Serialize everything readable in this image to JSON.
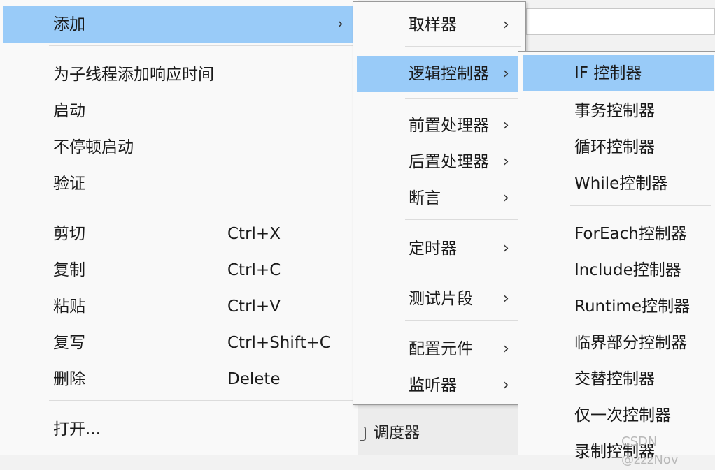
{
  "background": {
    "watermark": "CSDN @zzzNov",
    "underlying_label": "调度器"
  },
  "main_menu": {
    "add": {
      "label": "添加",
      "arrow": "›"
    },
    "group1": [
      {
        "label": "为子线程添加响应时间"
      },
      {
        "label": "启动"
      },
      {
        "label": "不停顿启动"
      },
      {
        "label": "验证"
      }
    ],
    "group2": [
      {
        "label": "剪切",
        "shortcut": "Ctrl+X"
      },
      {
        "label": "复制",
        "shortcut": "Ctrl+C"
      },
      {
        "label": "粘贴",
        "shortcut": "Ctrl+V"
      },
      {
        "label": "复写",
        "shortcut": "Ctrl+Shift+C"
      },
      {
        "label": "删除",
        "shortcut": "Delete"
      }
    ],
    "open": {
      "label": "打开..."
    }
  },
  "add_submenu": {
    "sampler": {
      "label": "取样器",
      "arrow": "›"
    },
    "logic": {
      "label": "逻辑控制器",
      "arrow": "›"
    },
    "pre": {
      "label": "前置处理器",
      "arrow": "›"
    },
    "post": {
      "label": "后置处理器",
      "arrow": "›"
    },
    "assertion": {
      "label": "断言",
      "arrow": "›"
    },
    "timer": {
      "label": "定时器",
      "arrow": "›"
    },
    "fragment": {
      "label": "测试片段",
      "arrow": "›"
    },
    "config": {
      "label": "配置元件",
      "arrow": "›"
    },
    "listener": {
      "label": "监听器",
      "arrow": "›"
    }
  },
  "logic_submenu": {
    "group1": [
      {
        "label": "IF 控制器"
      },
      {
        "label": "事务控制器"
      },
      {
        "label": "循环控制器"
      },
      {
        "label": "While控制器"
      }
    ],
    "group2": [
      {
        "label": "ForEach控制器"
      },
      {
        "label": "Include控制器"
      },
      {
        "label": "Runtime控制器"
      },
      {
        "label": "临界部分控制器"
      },
      {
        "label": "交替控制器"
      },
      {
        "label": "仅一次控制器"
      },
      {
        "label": "录制控制器"
      }
    ]
  }
}
